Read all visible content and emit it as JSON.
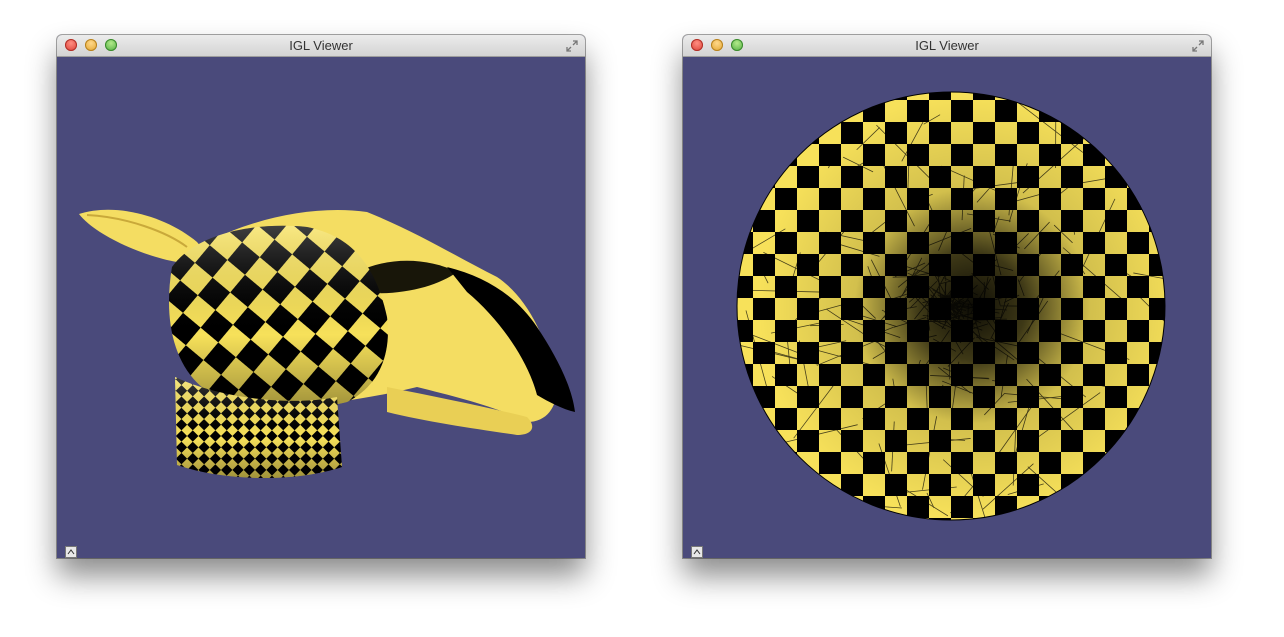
{
  "windows": [
    {
      "title": "IGL Viewer",
      "content": "3D mesh with checkerboard texture"
    },
    {
      "title": "IGL Viewer",
      "content": "2D parameterization disk with checkerboard"
    }
  ],
  "colors": {
    "background": "#4a4a7b",
    "checker_yellow": "#f7e15a",
    "checker_black": "#000000"
  },
  "icons": [
    "expand-icon",
    "wireframe-toggle-icon",
    "help-icon"
  ]
}
